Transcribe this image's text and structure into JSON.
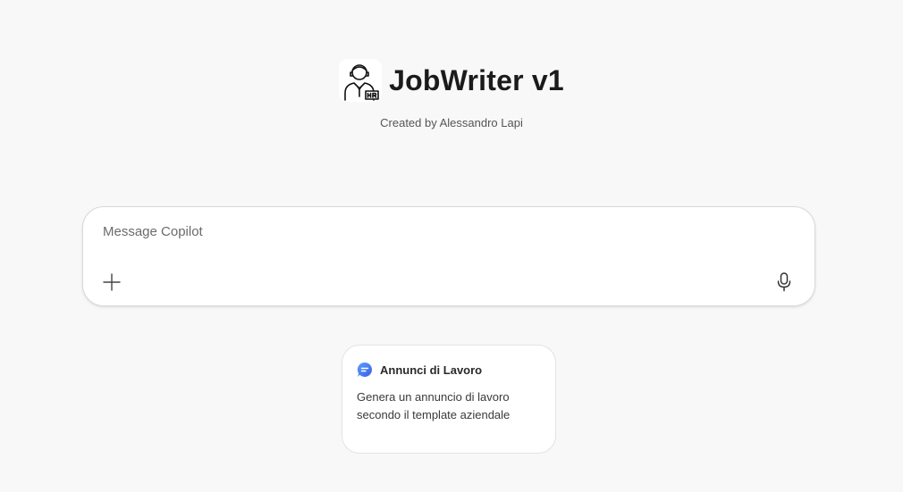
{
  "header": {
    "title": "JobWriter v1",
    "subtitle": "Created by Alessandro Lapi",
    "avatar_icon": "hr-person-icon"
  },
  "composer": {
    "placeholder": "Message Copilot",
    "value": "",
    "add_icon": "plus-icon",
    "mic_icon": "microphone-icon"
  },
  "suggestion": {
    "icon": "chat-bubble-icon",
    "title": "Annunci di Lavoro",
    "description": "Genera un annuncio di lavoro secondo il template aziendale",
    "accent": "#3b82f6"
  }
}
